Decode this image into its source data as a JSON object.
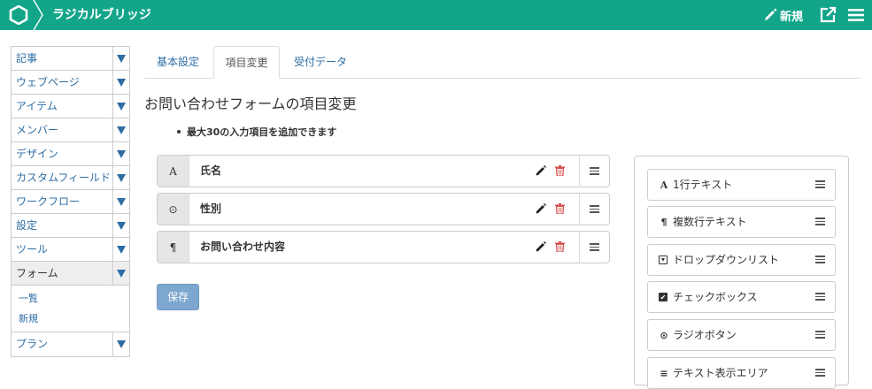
{
  "header": {
    "site_title": "ラジカルブリッジ",
    "new_label": "新規",
    "color": "#13a589"
  },
  "sidebar": {
    "items": [
      {
        "label": "記事"
      },
      {
        "label": "ウェブページ"
      },
      {
        "label": "アイテム"
      },
      {
        "label": "メンバー"
      },
      {
        "label": "デザイン"
      },
      {
        "label": "カスタムフィールド"
      },
      {
        "label": "ワークフロー"
      },
      {
        "label": "設定"
      },
      {
        "label": "ツール"
      },
      {
        "label": "フォーム"
      }
    ],
    "sub_items": [
      {
        "label": "一覧"
      },
      {
        "label": "新規"
      }
    ],
    "last_item": {
      "label": "プラン"
    }
  },
  "tabs": [
    {
      "label": "基本設定"
    },
    {
      "label": "項目変更"
    },
    {
      "label": "受付データ"
    }
  ],
  "main": {
    "title": "お問い合わせフォームの項目変更",
    "note": "最大30の入力項目を追加できます",
    "fields": [
      {
        "icon_glyph": "A",
        "icon": "text-line-icon",
        "name": "氏名"
      },
      {
        "icon_glyph": "⊙",
        "icon": "radio-icon",
        "name": "性別"
      },
      {
        "icon_glyph": "¶",
        "icon": "paragraph-icon",
        "name": "お問い合わせ内容"
      }
    ],
    "save_label": "保存"
  },
  "palette": {
    "items": [
      {
        "icon_glyph": "A",
        "icon": "text-line-icon",
        "label": "1行テキスト"
      },
      {
        "icon_glyph": "¶",
        "icon": "paragraph-icon",
        "label": "複数行テキスト"
      },
      {
        "icon_glyph": "▾",
        "icon": "dropdown-icon",
        "label": "ドロップダウンリスト"
      },
      {
        "icon_glyph": "✔",
        "icon": "checkbox-icon",
        "label": "チェックボックス"
      },
      {
        "icon_glyph": "⊙",
        "icon": "radio-icon",
        "label": "ラジオボタン"
      },
      {
        "icon_glyph": "≡",
        "icon": "text-display-icon",
        "label": "テキスト表示エリア"
      }
    ]
  }
}
